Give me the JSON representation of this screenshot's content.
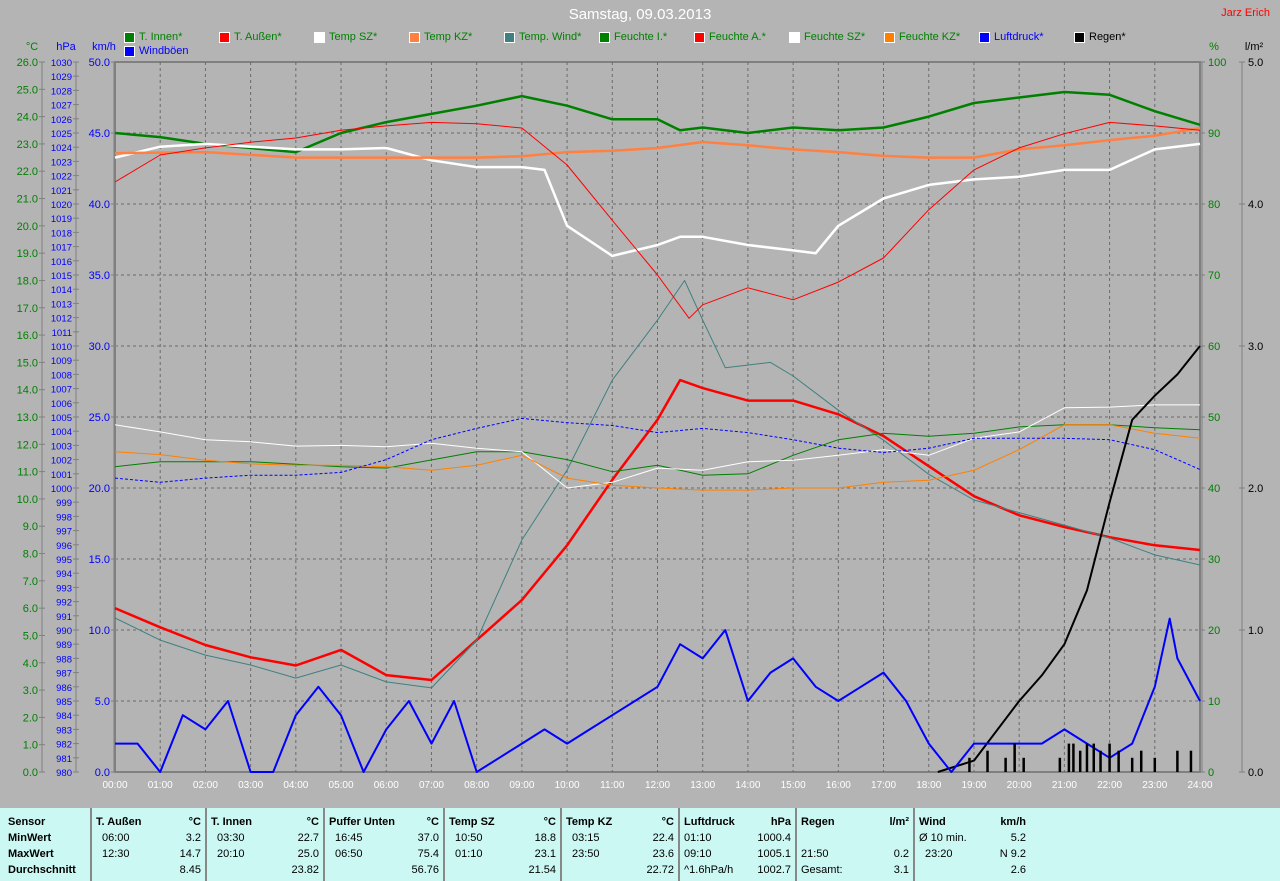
{
  "header": {
    "title": "Samstag, 09.03.2013",
    "author": "Jarz Erich"
  },
  "legend": [
    {
      "label": "T. Innen*",
      "color": "#008000",
      "text": "#008000"
    },
    {
      "label": "T. Außen*",
      "color": "#ff0000",
      "text": "#008000"
    },
    {
      "label": "Temp SZ*",
      "color": "#ffffff",
      "text": "#008000"
    },
    {
      "label": "Temp KZ*",
      "color": "#ff8040",
      "text": "#008000"
    },
    {
      "label": "Temp. Wind*",
      "color": "#408080",
      "text": "#008000"
    },
    {
      "label": "Feuchte I.*",
      "color": "#008000",
      "text": "#008000"
    },
    {
      "label": "Feuchte A.*",
      "color": "#ff0000",
      "text": "#008000"
    },
    {
      "label": "Feuchte SZ*",
      "color": "#ffffff",
      "text": "#008000"
    },
    {
      "label": "Feuchte KZ*",
      "color": "#ff8000",
      "text": "#008000"
    },
    {
      "label": "Luftdruck*",
      "color": "#0000ff",
      "text": "#0000ff"
    },
    {
      "label": "Regen*",
      "color": "#000000",
      "text": "#000000"
    },
    {
      "label": "Windböen",
      "color": "#0000ff",
      "text": "#0000ff"
    }
  ],
  "chart_data": {
    "type": "line",
    "title": "Samstag, 09.03.2013",
    "x_ticks": [
      "00:00",
      "01:00",
      "02:00",
      "03:00",
      "04:00",
      "05:00",
      "06:00",
      "07:00",
      "08:00",
      "09:00",
      "10:00",
      "11:00",
      "12:00",
      "13:00",
      "14:00",
      "15:00",
      "16:00",
      "17:00",
      "18:00",
      "19:00",
      "20:00",
      "21:00",
      "22:00",
      "23:00",
      "24:00"
    ],
    "xlim": [
      0,
      24
    ],
    "axes": {
      "temp": {
        "label": "°C",
        "range": [
          0,
          26
        ],
        "step": 1,
        "decimals": 1,
        "color": "#008000"
      },
      "pressure": {
        "label": "hPa",
        "range": [
          980,
          1030
        ],
        "step": 1,
        "decimals": 0,
        "color": "#0000ff"
      },
      "wind": {
        "label": "km/h",
        "range": [
          0,
          50
        ],
        "step": 5,
        "decimals": 1,
        "color": "#0000ff"
      },
      "humidity": {
        "label": "%",
        "range": [
          0,
          100
        ],
        "step": 10,
        "decimals": 0,
        "color": "#008000"
      },
      "rain": {
        "label": "l/m²",
        "range": [
          0,
          5
        ],
        "step": 1,
        "decimals": 1,
        "color": "#000000"
      }
    },
    "grid": true,
    "series": [
      {
        "name": "T. Innen*",
        "axis": "temp",
        "color": "#008000",
        "width": 2.5,
        "x": [
          0,
          1,
          2,
          3,
          4,
          5,
          6,
          7,
          8,
          9,
          10,
          11,
          12,
          12.5,
          13,
          14,
          15,
          16,
          17,
          18,
          19,
          20,
          21,
          22,
          23,
          24
        ],
        "y": [
          23.4,
          23.25,
          23.0,
          22.85,
          22.7,
          23.4,
          23.8,
          24.1,
          24.4,
          24.75,
          24.4,
          23.9,
          23.9,
          23.5,
          23.6,
          23.4,
          23.6,
          23.5,
          23.6,
          24.0,
          24.5,
          24.7,
          24.9,
          24.8,
          24.2,
          23.7
        ]
      },
      {
        "name": "T. Außen*",
        "axis": "temp",
        "color": "#ff0000",
        "width": 2.5,
        "x": [
          0,
          1,
          2,
          3,
          4,
          5,
          6,
          7,
          8,
          9,
          10,
          11,
          12,
          12.5,
          13,
          14,
          15,
          16,
          17,
          18,
          19,
          20,
          21,
          22,
          23,
          24
        ],
        "y": [
          6.0,
          5.3,
          4.65,
          4.2,
          3.9,
          4.47,
          3.55,
          3.37,
          4.83,
          6.3,
          8.3,
          10.7,
          12.9,
          14.35,
          14.06,
          13.6,
          13.6,
          13.1,
          12.3,
          11.2,
          10.1,
          9.4,
          8.97,
          8.6,
          8.3,
          8.13
        ]
      },
      {
        "name": "Temp SZ*",
        "axis": "temp",
        "color": "#ffffff",
        "width": 2.5,
        "x": [
          0,
          1,
          2,
          3,
          4,
          5,
          6,
          7,
          8,
          9,
          9.5,
          10,
          11,
          12,
          12.5,
          13,
          14,
          15,
          15.5,
          16,
          17,
          18,
          19,
          20,
          21,
          22,
          23,
          24
        ],
        "y": [
          22.5,
          22.9,
          23.0,
          22.9,
          22.8,
          22.8,
          22.85,
          22.4,
          22.15,
          22.15,
          22.05,
          20.0,
          18.9,
          19.3,
          19.6,
          19.6,
          19.3,
          19.1,
          19.0,
          20.0,
          21.0,
          21.5,
          21.7,
          21.8,
          22.05,
          22.05,
          22.8,
          23.0
        ]
      },
      {
        "name": "Temp KZ*",
        "axis": "temp",
        "color": "#ff8040",
        "width": 2.5,
        "x": [
          0,
          2,
          4,
          6,
          8,
          9,
          10,
          11,
          12,
          13,
          14,
          15,
          16,
          17,
          18,
          19,
          20,
          21,
          22,
          23,
          24
        ],
        "y": [
          22.66,
          22.7,
          22.5,
          22.5,
          22.5,
          22.55,
          22.7,
          22.75,
          22.85,
          23.07,
          22.95,
          22.8,
          22.7,
          22.56,
          22.5,
          22.5,
          22.8,
          22.95,
          23.14,
          23.3,
          23.58
        ]
      },
      {
        "name": "Temp. Wind*",
        "axis": "temp",
        "color": "#408080",
        "width": 1,
        "x": [
          0,
          1,
          2,
          3,
          4,
          5,
          6,
          7,
          8,
          9,
          10,
          11,
          12,
          12.6,
          13,
          13.5,
          14.5,
          15,
          16,
          17,
          18,
          19,
          20,
          21,
          22,
          23,
          24
        ],
        "y": [
          5.64,
          4.83,
          4.28,
          3.92,
          3.44,
          3.92,
          3.3,
          3.08,
          4.83,
          8.5,
          11.06,
          14.35,
          16.55,
          18.0,
          16.55,
          14.8,
          15.0,
          14.5,
          13.25,
          12.15,
          10.9,
          9.96,
          9.5,
          9.04,
          8.57,
          7.95,
          7.58
        ]
      },
      {
        "name": "Feuchte I.*",
        "axis": "humidity",
        "color": "#008000",
        "width": 1,
        "x": [
          0,
          1,
          3,
          5,
          6,
          8,
          9,
          10,
          11,
          12,
          13,
          14,
          15,
          16,
          17,
          18,
          19,
          20,
          21,
          22,
          23,
          24
        ],
        "y": [
          43,
          43.7,
          43.7,
          43,
          42.8,
          45.1,
          45.1,
          44,
          42.3,
          43.2,
          41.8,
          42,
          44.6,
          46.8,
          47.7,
          47.3,
          47.7,
          48.6,
          48.9,
          48.9,
          48.5,
          48.2
        ]
      },
      {
        "name": "Feuchte A.*",
        "axis": "humidity",
        "color": "#ff0000",
        "width": 1,
        "x": [
          0,
          1,
          2,
          3,
          4,
          5,
          6,
          7,
          8,
          9,
          10,
          11,
          12,
          12.7,
          13,
          14,
          15,
          16,
          17,
          18,
          19,
          20,
          21,
          22,
          23,
          24
        ],
        "y": [
          83.1,
          86.9,
          87.9,
          88.7,
          89.3,
          90.4,
          91,
          91.5,
          91.3,
          90.7,
          85.5,
          77.7,
          70,
          63.9,
          65.8,
          68.2,
          66.5,
          69,
          72.4,
          79.2,
          84.8,
          87.9,
          89.9,
          91.5,
          91,
          90.4
        ]
      },
      {
        "name": "Feuchte SZ*",
        "axis": "humidity",
        "color": "#ffffff",
        "width": 1,
        "x": [
          0,
          1,
          2,
          3,
          4,
          5,
          6,
          7,
          8,
          9,
          10,
          11,
          12,
          13,
          14,
          15,
          16,
          17,
          18,
          19,
          20,
          21,
          22,
          23,
          24
        ],
        "y": [
          48.9,
          47.9,
          46.8,
          46.5,
          45.9,
          46,
          45.8,
          46.3,
          45.6,
          45.1,
          40,
          40.8,
          42.8,
          42.5,
          43.7,
          43.9,
          44.6,
          45.4,
          44.6,
          47,
          47.9,
          51.3,
          51.4,
          51.7,
          51.7
        ]
      },
      {
        "name": "Feuchte KZ*",
        "axis": "humidity",
        "color": "#ff8000",
        "width": 1,
        "x": [
          0,
          1,
          2,
          3,
          4,
          5,
          6,
          7,
          8,
          9,
          10,
          11,
          12,
          13,
          14,
          15,
          16,
          17,
          18,
          19,
          20,
          21,
          22,
          23,
          24
        ],
        "y": [
          45.1,
          44.7,
          43.9,
          43.4,
          43.2,
          43.2,
          43,
          42.5,
          43.2,
          44.6,
          41.4,
          40.4,
          40,
          39.7,
          39.7,
          40,
          40,
          40.8,
          41.1,
          42.5,
          45.4,
          48.9,
          48.9,
          47.7,
          47
        ]
      },
      {
        "name": "Luftdruck*",
        "axis": "pressure",
        "color": "#0000ff",
        "width": 1,
        "dash": true,
        "x": [
          0,
          1,
          2,
          3,
          4,
          5,
          6,
          7,
          8,
          9,
          10,
          11,
          12,
          13,
          14,
          15,
          16,
          17,
          18,
          19,
          20,
          21,
          22,
          23,
          24
        ],
        "y": [
          1000.7,
          1000.4,
          1000.7,
          1000.9,
          1000.9,
          1001.1,
          1002,
          1003.4,
          1004.2,
          1004.9,
          1004.6,
          1004.4,
          1003.9,
          1004.2,
          1003.9,
          1003.4,
          1002.8,
          1002.5,
          1002.8,
          1003.5,
          1003.5,
          1003.5,
          1003.4,
          1002.7,
          1001.3
        ]
      },
      {
        "name": "Regen*",
        "axis": "rain",
        "color": "#000000",
        "width": 2,
        "x": [
          18.2,
          19,
          20,
          20.5,
          21,
          21.5,
          22,
          22.5,
          23,
          23.5,
          24
        ],
        "y": [
          0,
          0.08,
          0.5,
          0.68,
          0.9,
          1.28,
          1.9,
          2.48,
          2.65,
          2.8,
          3.0
        ]
      },
      {
        "name": "Windböen",
        "axis": "wind",
        "color": "#0000ff",
        "width": 2,
        "x": [
          0,
          0.5,
          1,
          1.5,
          2,
          2.5,
          3,
          3.5,
          4,
          4.5,
          5,
          5.5,
          6,
          6.5,
          7,
          7.5,
          8,
          8.5,
          9,
          9.5,
          10,
          10.5,
          11,
          11.5,
          12,
          12.5,
          13,
          13.5,
          14,
          14.5,
          15,
          15.5,
          16,
          16.5,
          17,
          17.5,
          18,
          18.5,
          19,
          19.5,
          20,
          20.5,
          21,
          21.5,
          22,
          22.5,
          23,
          23.33,
          23.5,
          24
        ],
        "y": [
          2,
          2,
          0,
          4,
          3,
          5,
          0,
          0,
          4,
          6,
          4,
          0,
          3,
          5,
          2,
          5,
          0,
          1,
          2,
          3,
          2,
          3,
          4,
          5,
          6,
          9,
          8,
          10,
          5,
          7,
          8,
          6,
          5,
          6,
          7,
          5,
          2,
          0,
          2,
          2,
          2,
          2,
          3,
          2,
          1,
          2,
          6,
          10.8,
          8,
          5
        ]
      }
    ],
    "rain_ticks": {
      "axis": "rain",
      "color": "#000000",
      "x": [
        18.9,
        19.3,
        19.7,
        19.9,
        20.1,
        20.9,
        21.1,
        21.2,
        21.35,
        21.5,
        21.65,
        21.8,
        22,
        22.2,
        22.5,
        22.7,
        23.0,
        23.5,
        23.8
      ],
      "y": [
        0.1,
        0.15,
        0.1,
        0.2,
        0.1,
        0.1,
        0.2,
        0.2,
        0.15,
        0.2,
        0.2,
        0.15,
        0.2,
        0.15,
        0.1,
        0.15,
        0.1,
        0.15,
        0.15
      ]
    }
  },
  "table": {
    "row_labels": [
      "Sensor",
      "MinWert",
      "MaxWert",
      "Durchschnitt"
    ],
    "sections": [
      {
        "name": "T. Außen",
        "unit": "°C",
        "rows": [
          [
            "06:00",
            "3.2"
          ],
          [
            "12:30",
            "14.7"
          ],
          [
            "",
            "8.45"
          ]
        ]
      },
      {
        "name": "T. Innen",
        "unit": "°C",
        "rows": [
          [
            "03:30",
            "22.7"
          ],
          [
            "20:10",
            "25.0"
          ],
          [
            "",
            "23.82"
          ]
        ]
      },
      {
        "name": "Puffer Unten",
        "unit": "°C",
        "rows": [
          [
            "16:45",
            "37.0"
          ],
          [
            "06:50",
            "75.4"
          ],
          [
            "",
            "56.76"
          ]
        ]
      },
      {
        "name": "Temp SZ",
        "unit": "°C",
        "rows": [
          [
            "10:50",
            "18.8"
          ],
          [
            "01:10",
            "23.1"
          ],
          [
            "",
            "21.54"
          ]
        ]
      },
      {
        "name": "Temp KZ",
        "unit": "°C",
        "rows": [
          [
            "03:15",
            "22.4"
          ],
          [
            "23:50",
            "23.6"
          ],
          [
            "",
            "22.72"
          ]
        ]
      },
      {
        "name": "Luftdruck",
        "unit": "hPa",
        "rows": [
          [
            "01:10",
            "1000.4"
          ],
          [
            "09:10",
            "1005.1"
          ],
          [
            "^1.6hPa/h",
            "1002.7"
          ]
        ]
      },
      {
        "name": "Regen",
        "unit": "l/m²",
        "rows": [
          [
            "",
            ""
          ],
          [
            "21:50",
            "0.2"
          ],
          [
            "Gesamt:",
            "3.1"
          ]
        ]
      },
      {
        "name": "Wind",
        "unit": "km/h",
        "rows": [
          [
            "Ø 10 min.",
            "5.2"
          ],
          [
            "23:20",
            "N 9.2"
          ],
          [
            "",
            "2.6"
          ]
        ]
      }
    ]
  }
}
